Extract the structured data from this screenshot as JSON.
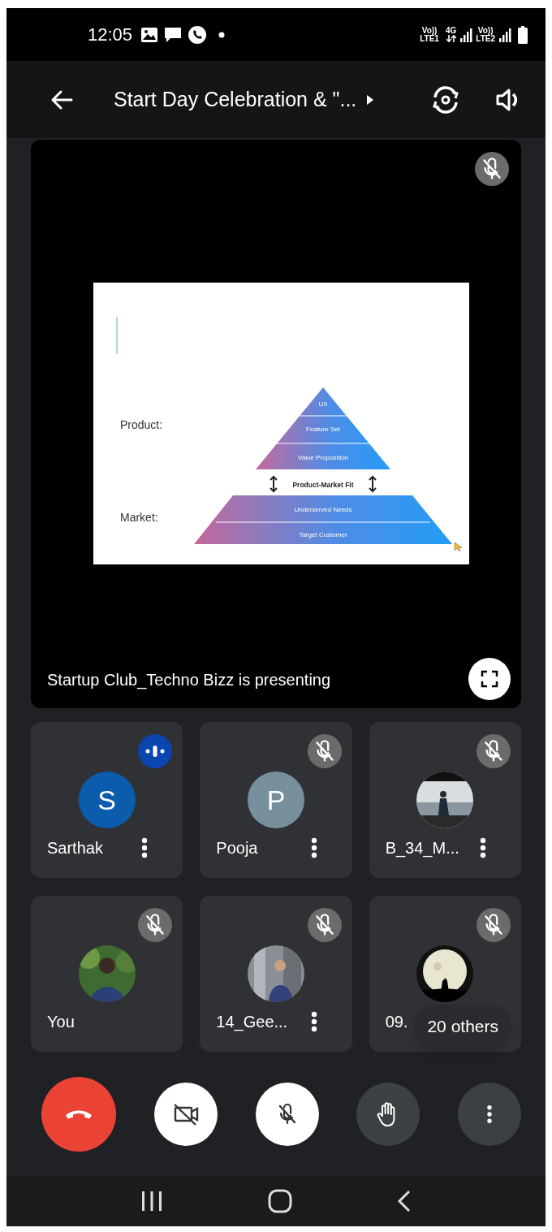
{
  "status_bar": {
    "time": "12:05",
    "sims": [
      {
        "top": "Vo))",
        "bottom": "LTE1",
        "data_top": "4G"
      },
      {
        "top": "Vo))",
        "bottom": "LTE2"
      }
    ]
  },
  "app_bar": {
    "title": "Start Day Celebration & \"..."
  },
  "presentation": {
    "slide": {
      "product_label": "Product:",
      "market_label": "Market:",
      "product_layers": [
        "UX",
        "Feature Set",
        "Value Proposition"
      ],
      "fit_label": "Product-Market Fit",
      "market_layers": [
        "Underserved Needs",
        "Target Customer"
      ]
    },
    "caption": "Startup Club_Techno Bizz is presenting"
  },
  "participants": [
    {
      "name": "Sarthak",
      "avatar": {
        "kind": "letter",
        "letter": "S",
        "color": "#0b5cad"
      },
      "muted": false,
      "more_menu": true
    },
    {
      "name": "Pooja",
      "avatar": {
        "kind": "letter",
        "letter": "P",
        "color": "#78909c"
      },
      "muted": true,
      "more_menu": true
    },
    {
      "name": "B_34_M...",
      "muted": true,
      "more_menu": true
    },
    {
      "name": "You",
      "muted": true,
      "more_menu": false
    },
    {
      "name": "14_Gee...",
      "muted": true,
      "more_menu": true
    },
    {
      "name": "09.",
      "muted": true,
      "more_menu": false
    }
  ],
  "others_label": "20 others",
  "controls": [
    {
      "kind": "end_call"
    },
    {
      "kind": "camera_off"
    },
    {
      "kind": "mic_off"
    },
    {
      "kind": "raise_hand"
    },
    {
      "kind": "more"
    }
  ]
}
